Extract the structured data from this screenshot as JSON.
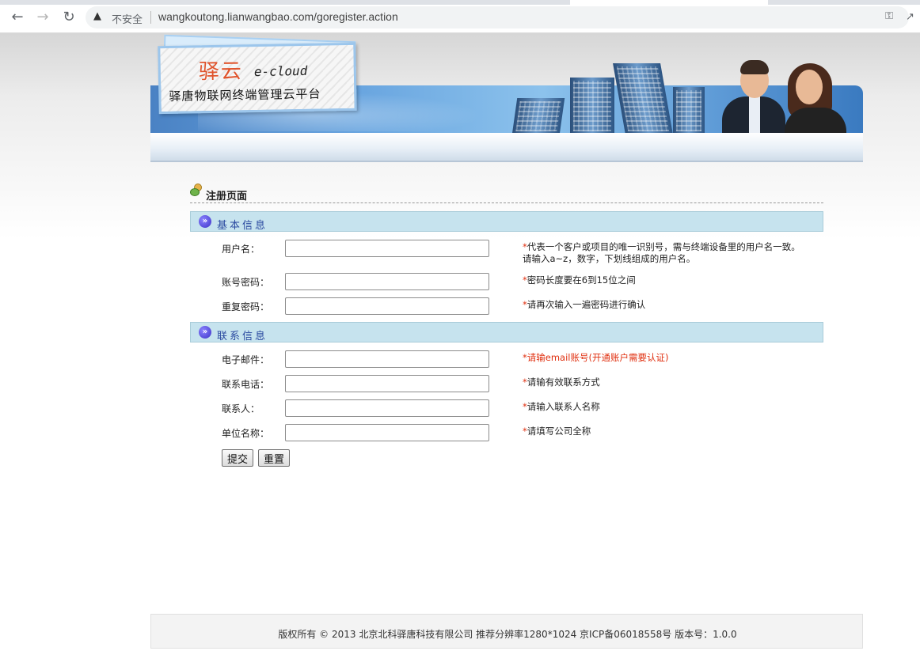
{
  "browser": {
    "insecure_label": "不安全",
    "url": "wangkoutong.lianwangbao.com/goregister.action"
  },
  "logo": {
    "name_cn": "驿云",
    "name_en": "e-cloud",
    "subtitle": "驿唐物联网终端管理云平台"
  },
  "page": {
    "heading": "注册页面"
  },
  "sections": {
    "basic": "基本信息",
    "contact": "联系信息"
  },
  "form": {
    "username": {
      "label": "用户名：",
      "hint": "代表一个客户或项目的唯一识别号，需与终端设备里的用户名一致。请输入a~z，数字，下划线组成的用户名。"
    },
    "password": {
      "label": "账号密码：",
      "hint": "密码长度要在6到15位之间"
    },
    "password_confirm": {
      "label": "重复密码：",
      "hint": "请再次输入一遍密码进行确认"
    },
    "email": {
      "label": "电子邮件：",
      "hint": "请输email账号(开通账户需要认证)"
    },
    "phone": {
      "label": "联系电话：",
      "hint": "请输有效联系方式"
    },
    "contact": {
      "label": "联系人：",
      "hint": "请输入联系人名称"
    },
    "company": {
      "label": "单位名称：",
      "hint": "请填写公司全称"
    },
    "required_mark": "*"
  },
  "buttons": {
    "submit": "提交",
    "reset": "重置"
  },
  "footer": {
    "text": "版权所有 © 2013 北京北科驿唐科技有限公司 推荐分辨率1280*1024 京ICP备06018558号 版本号：1.0.0"
  },
  "colors": {
    "section_bar": "#c6e3ee",
    "section_label": "#2b4aa0",
    "required": "#e03010"
  }
}
